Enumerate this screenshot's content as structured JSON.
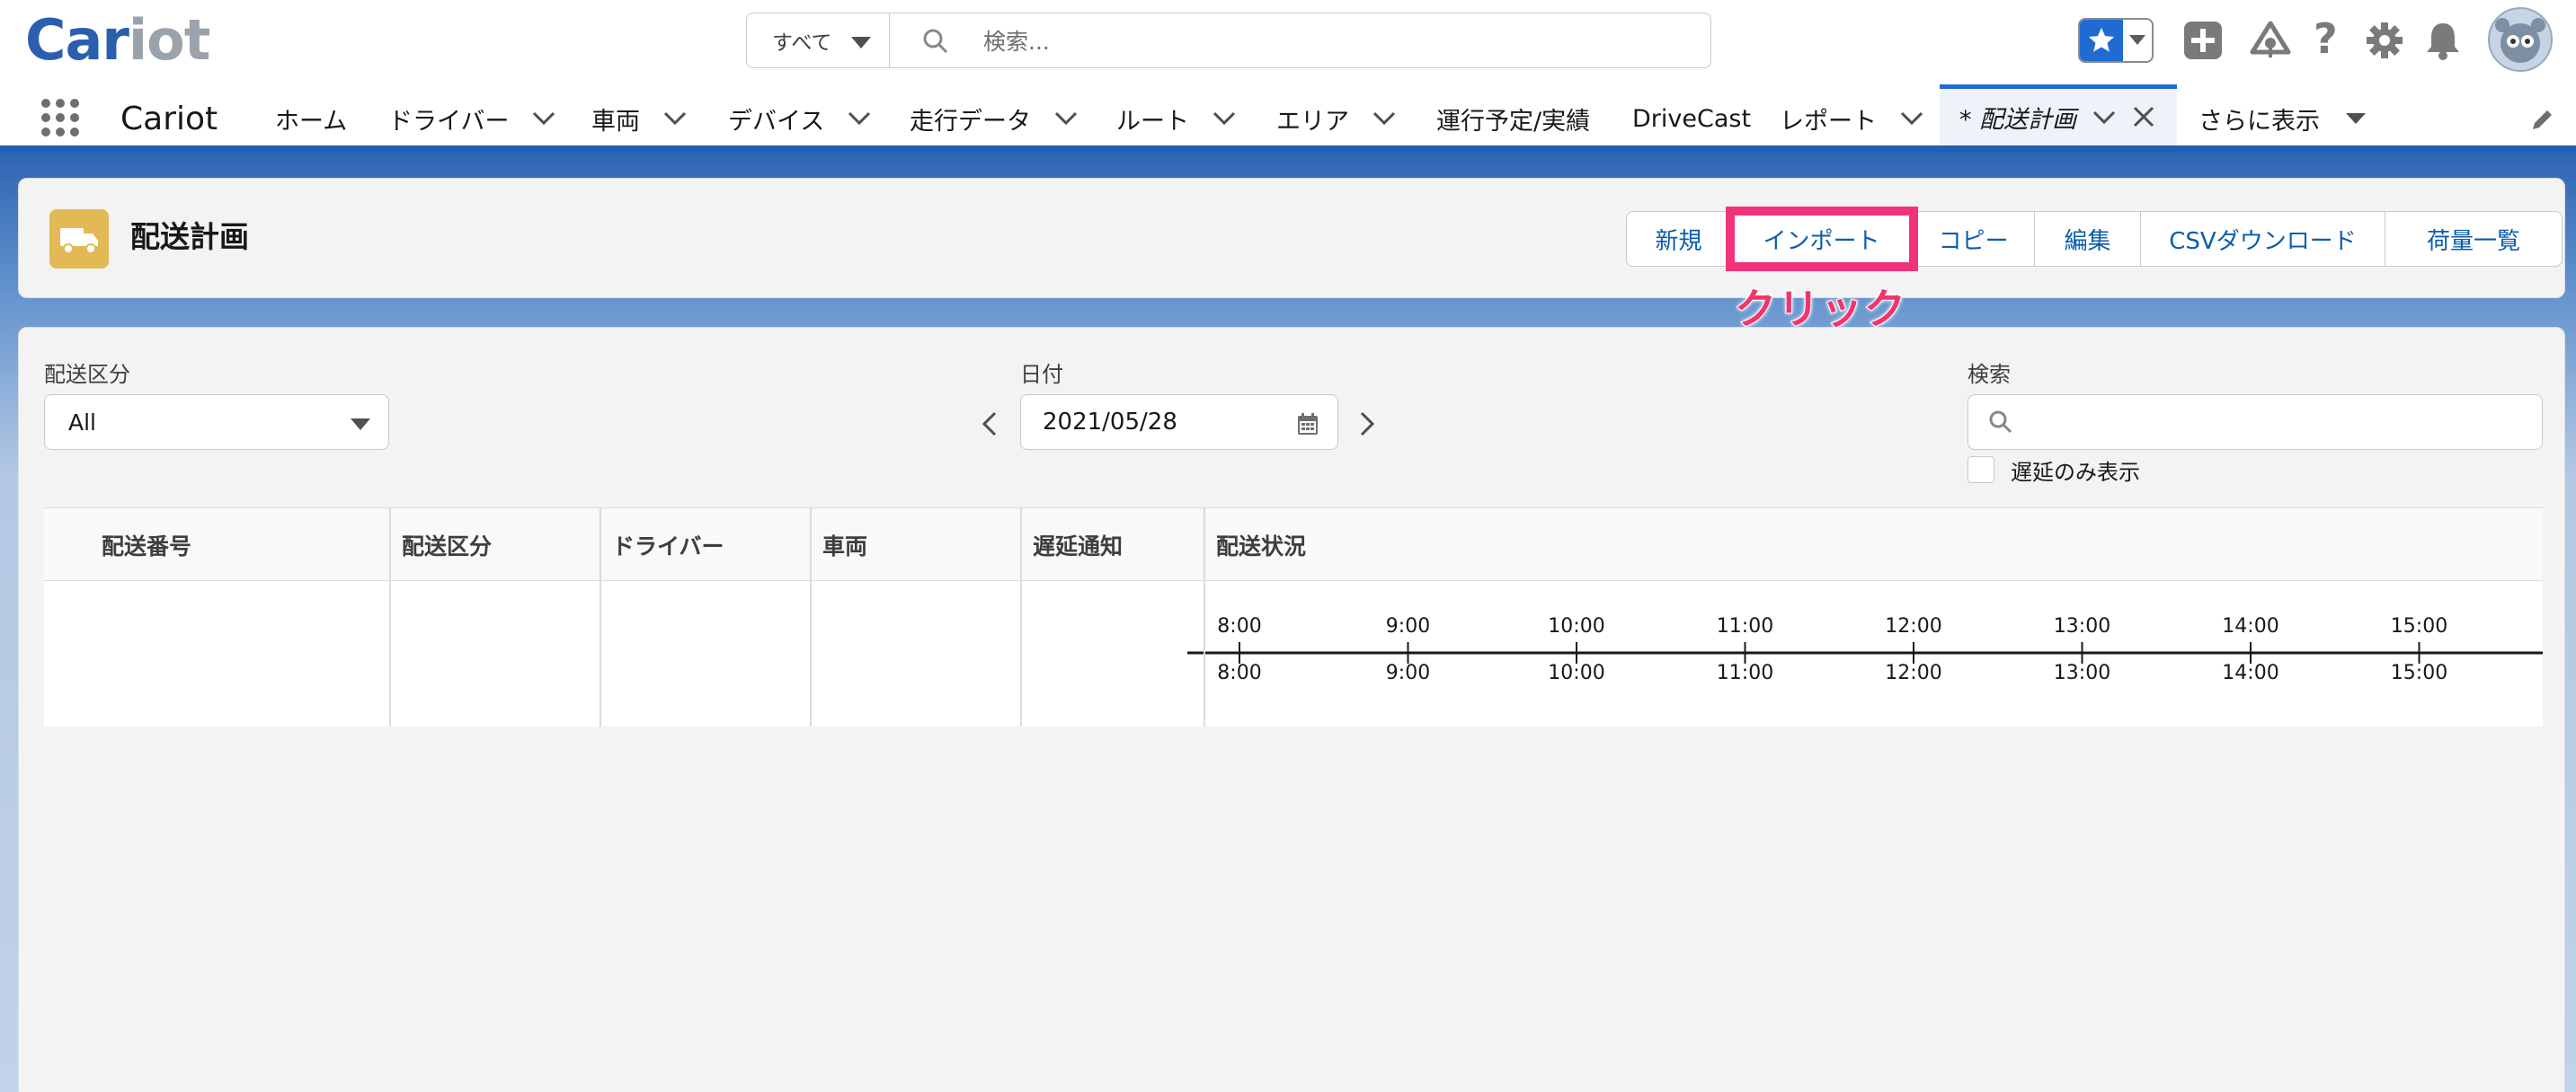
{
  "app": {
    "logo_part1": "Car",
    "logo_part2": "iot",
    "name": "Cariot"
  },
  "global_search": {
    "scope": "すべて",
    "placeholder": "検索..."
  },
  "header_icons": [
    "favorites-star-icon",
    "add-icon",
    "trailhead-icon",
    "help-icon",
    "setup-gear-icon",
    "notification-bell-icon",
    "user-avatar"
  ],
  "nav": {
    "items": [
      {
        "label": "ホーム",
        "dropdown": false
      },
      {
        "label": "ドライバー",
        "dropdown": true
      },
      {
        "label": "車両",
        "dropdown": true
      },
      {
        "label": "デバイス",
        "dropdown": true
      },
      {
        "label": "走行データ",
        "dropdown": true
      },
      {
        "label": "ルート",
        "dropdown": true
      },
      {
        "label": "エリア",
        "dropdown": true
      },
      {
        "label": "運行予定/実績",
        "dropdown": false
      },
      {
        "label": "DriveCast",
        "dropdown": false
      },
      {
        "label": "レポート",
        "dropdown": true
      }
    ],
    "active_tab": "* 配送計画",
    "more": "さらに表示"
  },
  "page": {
    "title": "配送計画",
    "buttons": [
      "新規",
      "インポート",
      "コピー",
      "編集",
      "CSVダウンロード",
      "荷量一覧"
    ],
    "callout": "クリック"
  },
  "filters": {
    "category_label": "配送区分",
    "category_value": "All",
    "date_label": "日付",
    "date_value": "2021/05/28",
    "search_label": "検索",
    "search_value": "",
    "delay_only_label": "遅延のみ表示",
    "delay_only_checked": false
  },
  "table": {
    "columns": [
      "配送番号",
      "配送区分",
      "ドライバー",
      "車両",
      "遅延通知",
      "配送状況"
    ],
    "timeline_ticks": [
      "8:00",
      "9:00",
      "10:00",
      "11:00",
      "12:00",
      "13:00",
      "14:00",
      "15:00"
    ]
  },
  "colors": {
    "brand_blue": "#1f6bd2",
    "link_blue": "#0b5cab",
    "highlight_pink": "#f0337a",
    "object_icon": "#e2b955"
  }
}
